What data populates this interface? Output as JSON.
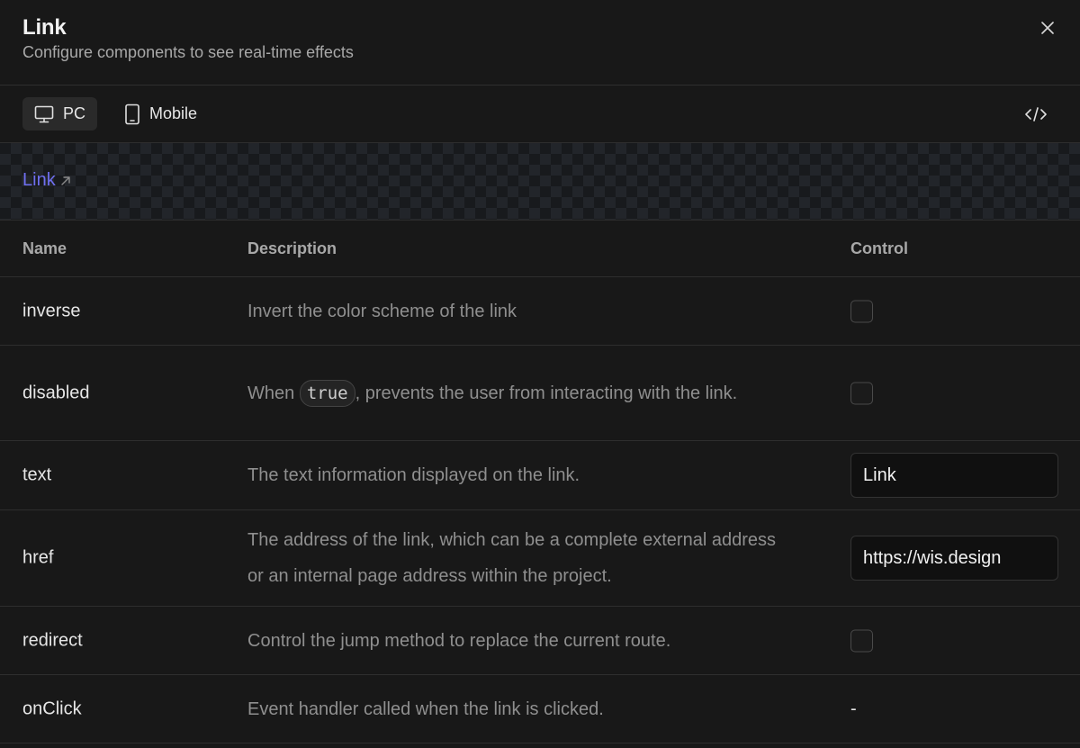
{
  "header": {
    "title": "Link",
    "subtitle": "Configure components to see real-time effects"
  },
  "toolbar": {
    "pc_label": "PC",
    "mobile_label": "Mobile",
    "selected": "PC"
  },
  "preview": {
    "link_text": "Link"
  },
  "table": {
    "columns": {
      "name": "Name",
      "description": "Description",
      "control": "Control"
    },
    "rows": [
      {
        "name": "inverse",
        "description": "Invert the color scheme of the link",
        "control": "checkbox",
        "checked": false
      },
      {
        "name": "disabled",
        "description_before": "When",
        "description_code": "true",
        "description_after": ", prevents the user from interacting with the link.",
        "control": "checkbox",
        "checked": false
      },
      {
        "name": "text",
        "description": "The text information displayed on the link.",
        "control": "input",
        "value": "Link"
      },
      {
        "name": "href",
        "description": "The address of the link, which can be a complete external address or an internal page address within the project.",
        "control": "input",
        "value": "https://wis.design"
      },
      {
        "name": "redirect",
        "description": "Control the jump method to replace the current route.",
        "control": "checkbox",
        "checked": false
      },
      {
        "name": "onClick",
        "description": "Event handler called when the link is clicked.",
        "control": "none",
        "value": "-"
      }
    ]
  },
  "colors": {
    "background": "#181818",
    "border": "#2e2e2e",
    "link": "#6f6ff0",
    "muted_text": "#8f8f8f"
  }
}
